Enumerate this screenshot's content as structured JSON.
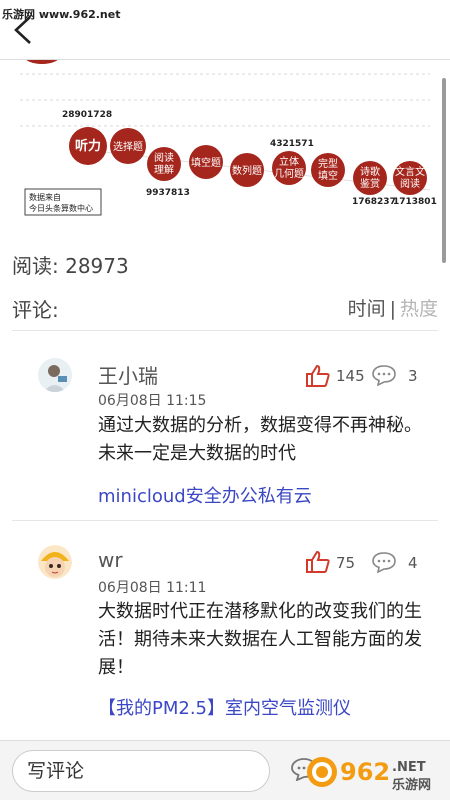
{
  "watermark_top": "乐游网 www.962.net",
  "infographic": {
    "source_line1": "数据来自",
    "source_line2": "今日头条算数中心",
    "bubbles": [
      {
        "label": "听力"
      },
      {
        "label": "选择题"
      },
      {
        "label": "阅读\n理解"
      },
      {
        "label": "填空题"
      },
      {
        "label": "数列题"
      },
      {
        "label": "立体\n几何题"
      },
      {
        "label": "完型\n填空"
      },
      {
        "label": "诗歌\n鉴赏"
      },
      {
        "label": "文言文\n阅读"
      }
    ],
    "numbers": {
      "n1": "28901728",
      "n2": "9937813",
      "n3": "4321571",
      "n4": "1768237",
      "n5": "1713801"
    }
  },
  "read": {
    "label": "阅读:",
    "count": "28973"
  },
  "comments_label": "评论:",
  "sort": {
    "time": "时间",
    "separator": "|",
    "hot": "热度"
  },
  "comments": [
    {
      "username": "王小瑞",
      "timestamp": "06月08日 11:15",
      "content": "通过大数据的分析，数据变得不再神秘。未来一定是大数据的时代",
      "likes": "145",
      "replies": "3",
      "ad": "minicloud安全办公私有云"
    },
    {
      "username": "wr",
      "timestamp": "06月08日 11:11",
      "content": "大数据时代正在潜移默化的改变我们的生活！期待未来大数据在人工智能方面的发展！",
      "likes": "75",
      "replies": "4",
      "ad": "【我的PM2.5】室内空气监测仪"
    }
  ],
  "bottom": {
    "placeholder": "写评论"
  },
  "watermark_logo": {
    "brand": "962",
    "domain": ".NET",
    "sub": "乐游网"
  },
  "colors": {
    "accent_red": "#d23b2c",
    "bubble_red": "#a5261d",
    "link_blue": "#3b47c4"
  }
}
